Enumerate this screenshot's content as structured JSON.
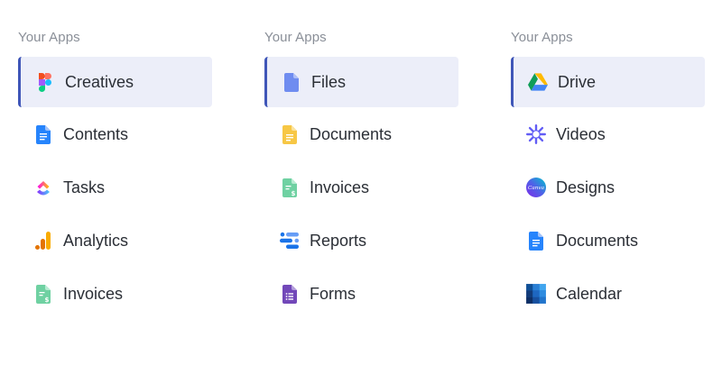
{
  "columns": [
    {
      "heading": "Your Apps",
      "items": [
        {
          "label": "Creatives",
          "icon": "figma-icon",
          "active": true
        },
        {
          "label": "Contents",
          "icon": "google-docs-icon",
          "active": false
        },
        {
          "label": "Tasks",
          "icon": "clickup-icon",
          "active": false
        },
        {
          "label": "Analytics",
          "icon": "google-analytics-icon",
          "active": false
        },
        {
          "label": "Invoices",
          "icon": "google-sheets-icon",
          "active": false
        }
      ]
    },
    {
      "heading": "Your Apps",
      "items": [
        {
          "label": "Files",
          "icon": "file-icon",
          "active": true
        },
        {
          "label": "Documents",
          "icon": "google-keep-icon",
          "active": false
        },
        {
          "label": "Invoices",
          "icon": "google-sheets-icon",
          "active": false
        },
        {
          "label": "Reports",
          "icon": "data-studio-icon",
          "active": false
        },
        {
          "label": "Forms",
          "icon": "google-forms-icon",
          "active": false
        }
      ]
    },
    {
      "heading": "Your Apps",
      "items": [
        {
          "label": "Drive",
          "icon": "google-drive-icon",
          "active": true
        },
        {
          "label": "Videos",
          "icon": "loom-icon",
          "active": false
        },
        {
          "label": "Designs",
          "icon": "canva-icon",
          "active": false,
          "icon_text": "Canva"
        },
        {
          "label": "Documents",
          "icon": "google-docs-icon",
          "active": false
        },
        {
          "label": "Calendar",
          "icon": "outlook-calendar-icon",
          "active": false
        }
      ]
    }
  ],
  "colors": {
    "active_bg": "#eceef9",
    "active_border": "#3f56b8",
    "heading": "#8a8f98",
    "label": "#2b2f36"
  }
}
